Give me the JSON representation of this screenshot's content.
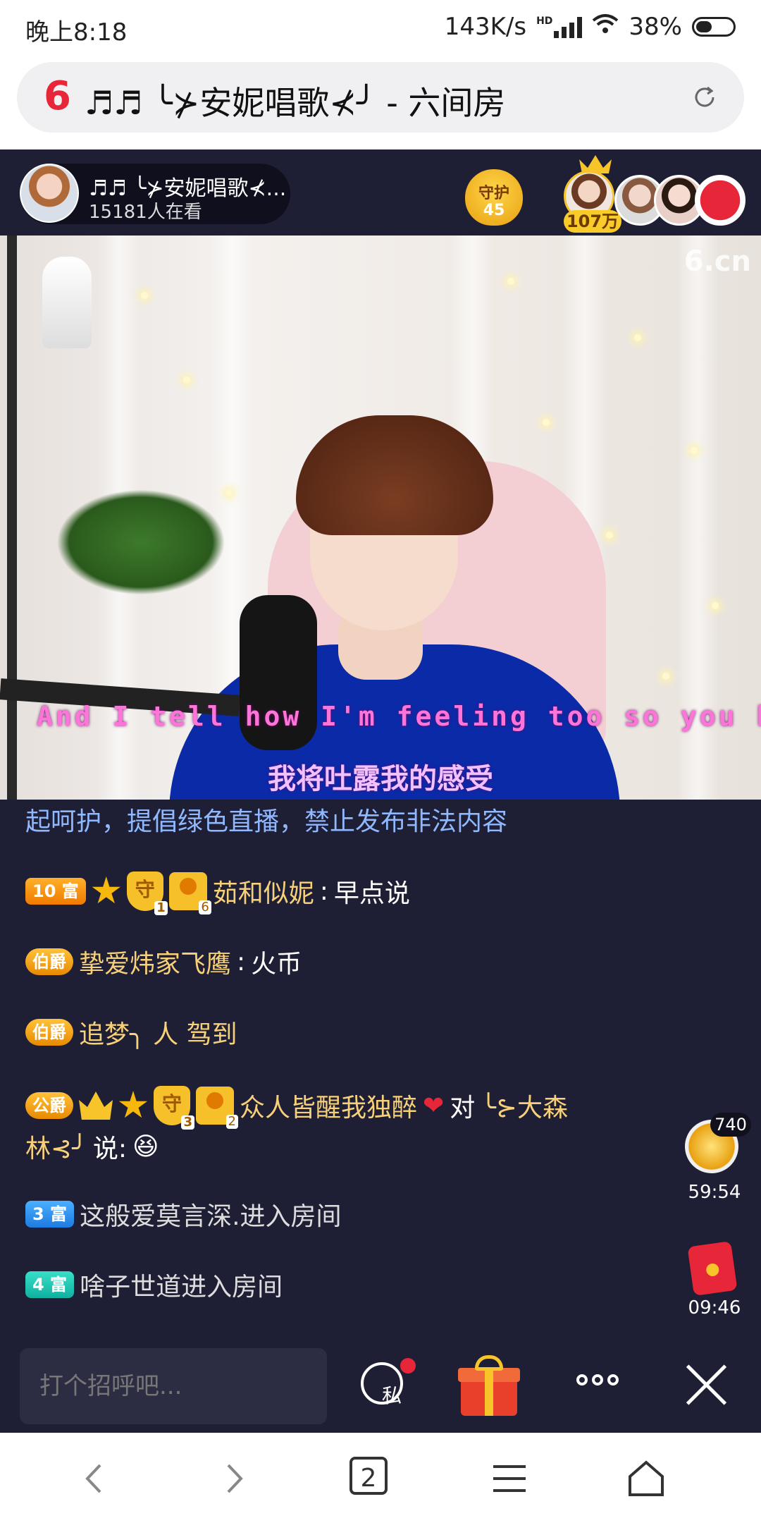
{
  "status_bar": {
    "time": "晚上8:18",
    "speed": "143K/s",
    "network": "HD",
    "battery": "38%"
  },
  "browser": {
    "url_title": "♬♬ ╰⊁安妮唱歌⊀╯ - 六间房",
    "logo": "6",
    "tab_count": "2"
  },
  "host": {
    "name": "♬♬ ╰⊁安妮唱歌⊀...",
    "viewers": "15181人在看"
  },
  "guard": {
    "label": "守护",
    "count": "45"
  },
  "top_fans": {
    "count": "107万"
  },
  "video": {
    "watermark": "6.cn",
    "lyric_en": "And I tell how I'm feeling too so you knc",
    "lyric_zh": "我将吐露我的感受"
  },
  "chat": {
    "notice": "起呵护，提倡绿色直播，禁止发布非法内容",
    "messages": [
      {
        "badge": "10 富",
        "user": "茹和似妮",
        "sep": ":",
        "text": "早点说",
        "shield_level": "1",
        "user_level": "6"
      },
      {
        "badge": "伯爵",
        "user": "挚爱炜家飞鹰",
        "sep": ":",
        "text": "火币"
      },
      {
        "badge": "伯爵",
        "text": "追梦╮ 人 驾到"
      },
      {
        "badge": "公爵",
        "user": "众人皆醒我独醉",
        "heart": "❤",
        "text_a": "对",
        "target": "╰⊱大森",
        "target2": "林⊰╯",
        "text_b": "说:",
        "emoji": "😆",
        "shield_level": "3",
        "user_level": "2"
      },
      {
        "badge": "3 富",
        "text": "这般爱莫言深.进入房间"
      },
      {
        "badge": "4 富",
        "text": "啥子世道进入房间"
      }
    ]
  },
  "widgets": {
    "treasure_count": "740",
    "treasure_time": "59:54",
    "redpacket_time": "09:46"
  },
  "input": {
    "placeholder": "打个招呼吧...",
    "private_label": "私"
  }
}
